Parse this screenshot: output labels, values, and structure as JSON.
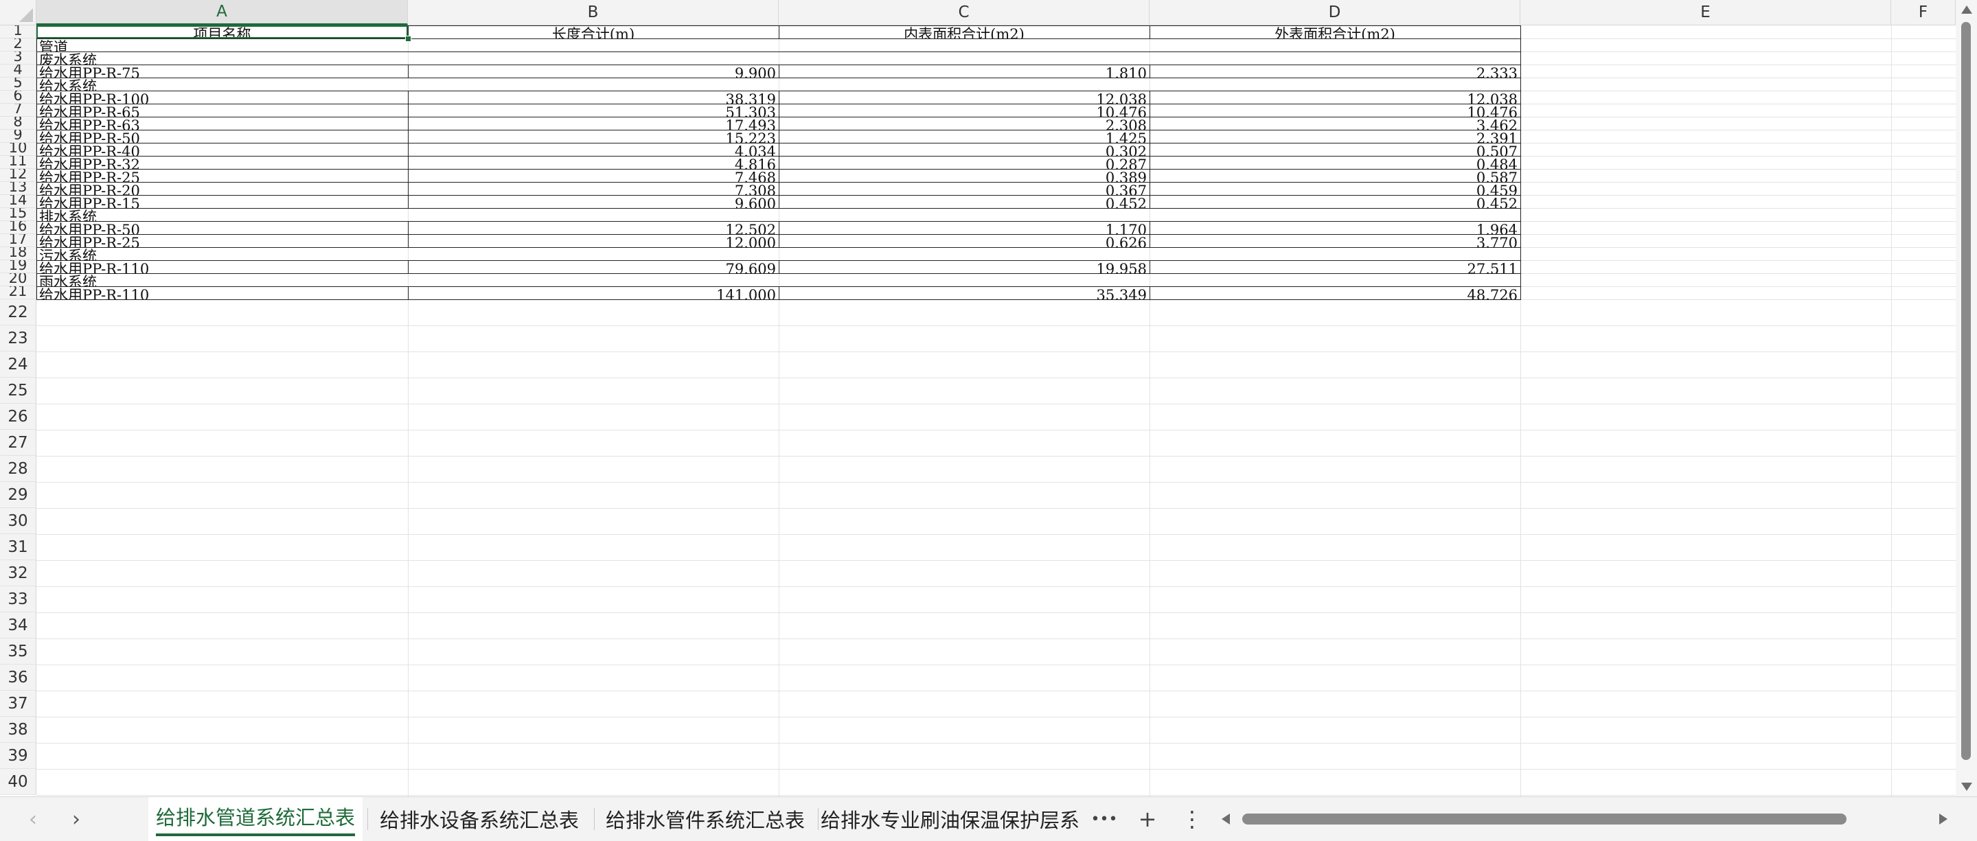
{
  "columns": [
    "A",
    "B",
    "C",
    "D",
    "E",
    "F"
  ],
  "active_column": "A",
  "rows": [
    "1",
    "2",
    "3",
    "4",
    "5",
    "6",
    "7",
    "8",
    "9",
    "10",
    "11",
    "12",
    "13",
    "14",
    "15",
    "16",
    "17",
    "18",
    "19",
    "20",
    "21",
    "22",
    "23",
    "24",
    "25",
    "26",
    "27",
    "28",
    "29",
    "30",
    "31",
    "32",
    "33",
    "34",
    "35",
    "36",
    "37",
    "38",
    "39",
    "40"
  ],
  "table": {
    "headers": [
      "项目名称",
      "长度合计(m)",
      "内表面积合计(m2)",
      "外表面积合计(m2)"
    ],
    "rows": [
      [
        "管道",
        "",
        "",
        ""
      ],
      [
        "废水系统",
        "",
        "",
        ""
      ],
      [
        "给水用PP-R-75",
        "9.900",
        "1.810",
        "2.333"
      ],
      [
        "给水系统",
        "",
        "",
        ""
      ],
      [
        "给水用PP-R-100",
        "38.319",
        "12.038",
        "12.038"
      ],
      [
        "给水用PP-R-65",
        "51.303",
        "10.476",
        "10.476"
      ],
      [
        "给水用PP-R-63",
        "17.493",
        "2.308",
        "3.462"
      ],
      [
        "给水用PP-R-50",
        "15.223",
        "1.425",
        "2.391"
      ],
      [
        "给水用PP-R-40",
        "4.034",
        "0.302",
        "0.507"
      ],
      [
        "给水用PP-R-32",
        "4.816",
        "0.287",
        "0.484"
      ],
      [
        "给水用PP-R-25",
        "7.468",
        "0.389",
        "0.587"
      ],
      [
        "给水用PP-R-20",
        "7.308",
        "0.367",
        "0.459"
      ],
      [
        "给水用PP-R-15",
        "9.600",
        "0.452",
        "0.452"
      ],
      [
        "排水系统",
        "",
        "",
        ""
      ],
      [
        "给水用PP-R-50",
        "12.502",
        "1.170",
        "1.964"
      ],
      [
        "给水用PP-R-25",
        "12.000",
        "0.626",
        "3.770"
      ],
      [
        "污水系统",
        "",
        "",
        ""
      ],
      [
        "给水用PP-R-110",
        "79.609",
        "19.958",
        "27.511"
      ],
      [
        "雨水系统",
        "",
        "",
        ""
      ],
      [
        "给水用PP-R-110",
        "141.000",
        "35.349",
        "48.726"
      ]
    ]
  },
  "sheet_tabs": [
    "给排水管道系统汇总表",
    "给排水设备系统汇总表",
    "给排水管件系统汇总表",
    "给排水专业刷油保温保护层系"
  ],
  "active_tab": 0,
  "tabbar": {
    "prev_icon": "‹",
    "next_icon": "›",
    "more_tabs_icon": "•••",
    "add_sheet_icon": "+",
    "menu_icon": "⋮"
  },
  "colors": {
    "accent": "#1e6b3a",
    "header_bg": "#f3f3f3",
    "grid": "#e3e3e3"
  }
}
